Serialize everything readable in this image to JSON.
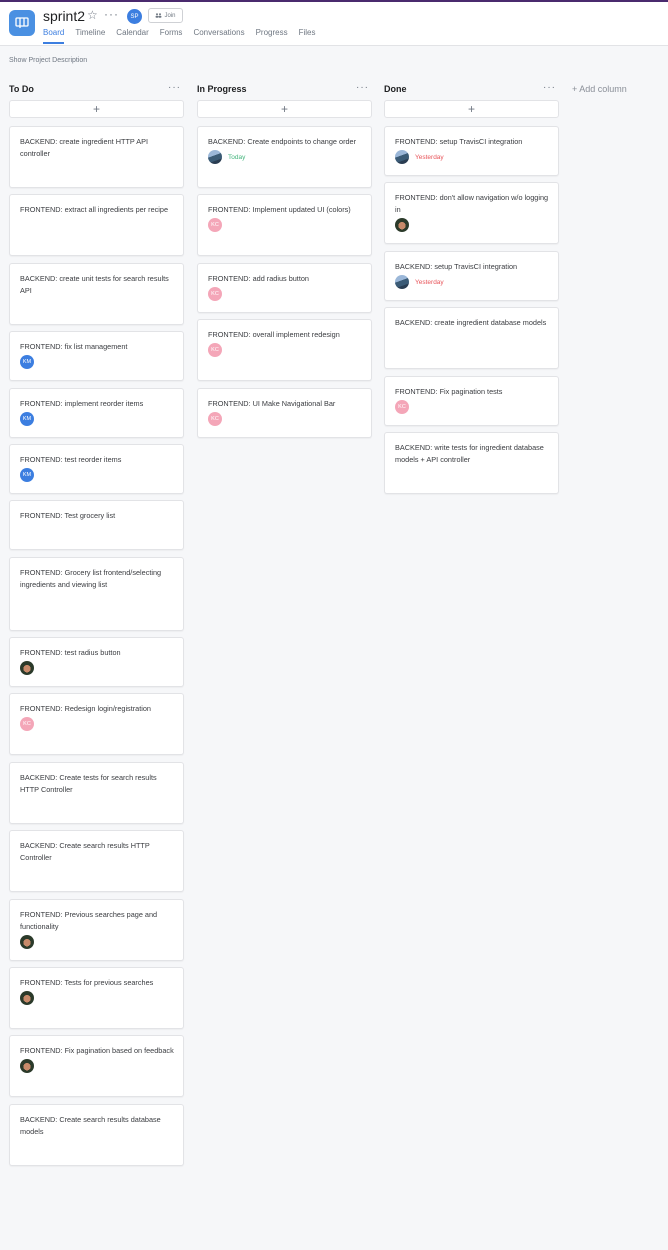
{
  "project": {
    "title": "sprint2",
    "member_initials": "SP",
    "join_label": "Join",
    "show_description": "Show Project Description",
    "accent": "#3c7ee0"
  },
  "tabs": [
    {
      "label": "Board",
      "active": true
    },
    {
      "label": "Timeline"
    },
    {
      "label": "Calendar"
    },
    {
      "label": "Forms"
    },
    {
      "label": "Conversations"
    },
    {
      "label": "Progress"
    },
    {
      "label": "Files"
    }
  ],
  "columns": [
    {
      "title": "To Do",
      "cards": [
        {
          "text": "BACKEND: create ingredient HTTP API controller"
        },
        {
          "text": "FRONTEND: extract all ingredients per recipe"
        },
        {
          "text": "BACKEND: create unit tests for search results API"
        },
        {
          "text": "FRONTEND: fix list management",
          "assignee": "KM"
        },
        {
          "text": "FRONTEND: implement reorder items",
          "assignee": "KM"
        },
        {
          "text": "FRONTEND: test reorder items",
          "assignee": "KM"
        },
        {
          "text": "FRONTEND: Test grocery list"
        },
        {
          "text": "FRONTEND: Grocery list frontend/selecting ingredients and viewing list"
        },
        {
          "text": "FRONTEND: test radius button",
          "assignee_photo": "dark"
        },
        {
          "text": "FRONTEND: Redesign login/registration",
          "assignee": "KC"
        },
        {
          "text": "BACKEND: Create tests for search results HTTP Controller"
        },
        {
          "text": "BACKEND: Create search results HTTP Controller"
        },
        {
          "text": "FRONTEND: Previous searches page and functionality",
          "assignee_photo": "dark"
        },
        {
          "text": "FRONTEND: Tests for previous searches",
          "assignee_photo": "dark"
        },
        {
          "text": "FRONTEND: Fix pagination based on feedback",
          "assignee_photo": "dark"
        },
        {
          "text": "BACKEND: Create search results database models"
        }
      ]
    },
    {
      "title": "In Progress",
      "cards": [
        {
          "text": "BACKEND: Create endpoints to change order",
          "assignee_photo": "land",
          "due": "Today",
          "due_color": "#43b57c"
        },
        {
          "text": "FRONTEND: Implement updated UI (colors)",
          "assignee": "KC"
        },
        {
          "text": "FRONTEND: add radius button",
          "assignee": "KC"
        },
        {
          "text": "FRONTEND: overall implement redesign",
          "assignee": "KC"
        },
        {
          "text": "FRONTEND: UI Make Navigational Bar",
          "assignee": "KC"
        }
      ]
    },
    {
      "title": "Done",
      "cards": [
        {
          "text": "FRONTEND: setup TravisCI integration",
          "assignee_photo": "land",
          "due": "Yesterday",
          "due_color": "#e8555b"
        },
        {
          "text": "FRONTEND: don't allow navigation w/o logging in",
          "assignee_photo": "dark"
        },
        {
          "text": "BACKEND: setup TravisCI integration",
          "assignee_photo": "land",
          "due": "Yesterday",
          "due_color": "#e8555b"
        },
        {
          "text": "BACKEND: create ingredient database models"
        },
        {
          "text": "FRONTEND: Fix pagination tests",
          "assignee": "KC"
        },
        {
          "text": "BACKEND: write tests for ingredient database models + API controller"
        }
      ]
    }
  ],
  "add_column_label": "+ Add column"
}
